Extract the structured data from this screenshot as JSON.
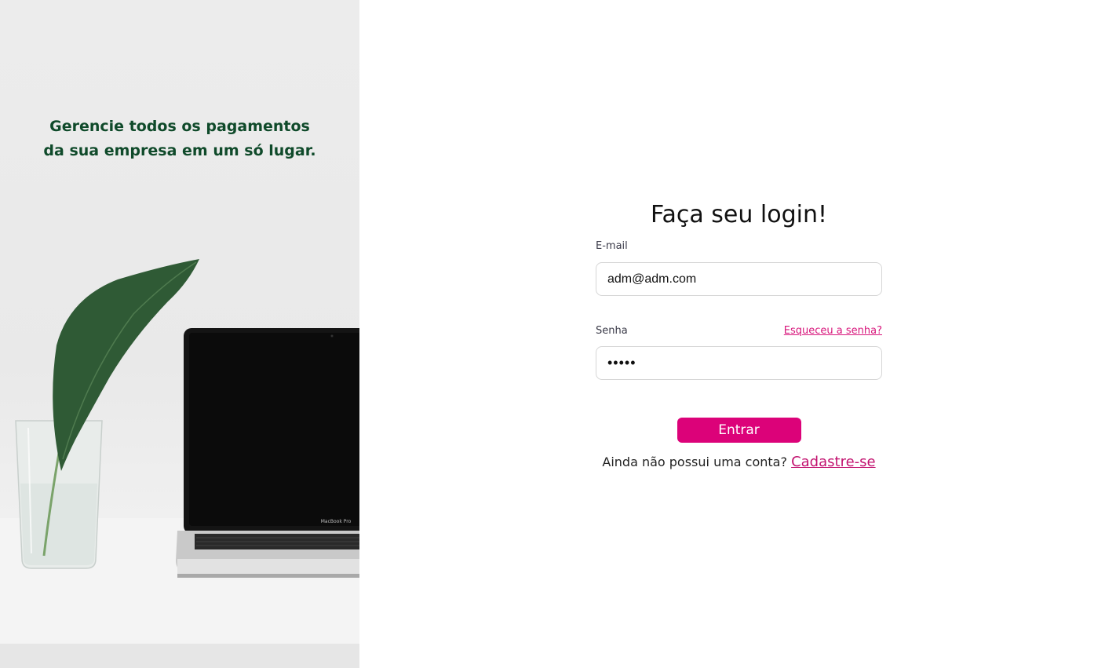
{
  "hero": {
    "tagline": "Gerencie todos os pagamentos da sua empresa em um só lugar.",
    "laptop_brand": "MacBook Pro",
    "text_color": "#0f4a2a"
  },
  "login": {
    "title": "Faça seu login!",
    "email_label": "E-mail",
    "email_value": "adm@adm.com",
    "password_label": "Senha",
    "password_value": "admin",
    "forgot_link": "Esqueceu a senha?",
    "submit_label": "Entrar",
    "signup_prompt": "Ainda não possui uma conta?",
    "signup_link": "Cadastre-se",
    "accent_color": "#dc0279"
  }
}
